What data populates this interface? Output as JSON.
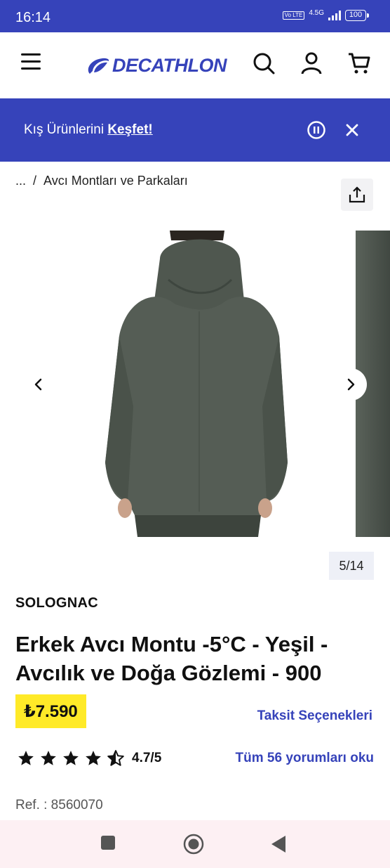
{
  "status_bar": {
    "time": "16:14",
    "volte": "Vo LTE",
    "network": "4.5G",
    "battery": "100"
  },
  "header": {
    "logo_text": "DECATHLON",
    "brand_color": "#3643ba",
    "icons": [
      "menu-icon",
      "search-icon",
      "account-icon",
      "cart-icon"
    ]
  },
  "banner": {
    "text": "Kış Ürünlerini ",
    "link": "Keşfet!",
    "icons": [
      "pause-icon",
      "close-icon"
    ]
  },
  "breadcrumb": {
    "ellipsis": "...",
    "separator": "/",
    "current": "Avcı Montları ve Parkaları"
  },
  "gallery": {
    "counter": "5/14"
  },
  "product": {
    "brand": "SOLOGNAC",
    "title": "Erkek Avcı Montu -5°C - Yeşil - Avcılık ve Doğa Gözlemi - 900",
    "price": "₺7.590",
    "price_bg": "#ffea28",
    "installment_link": "Taksit Seçenekleri",
    "rating_value": 4.7,
    "rating_text": "4.7/5",
    "reviews_link": "Tüm 56 yorumları oku",
    "ref": "Ref. : 8560070"
  },
  "nav_bar": {
    "icons": [
      "recent-apps-icon",
      "home-icon",
      "back-icon"
    ]
  }
}
